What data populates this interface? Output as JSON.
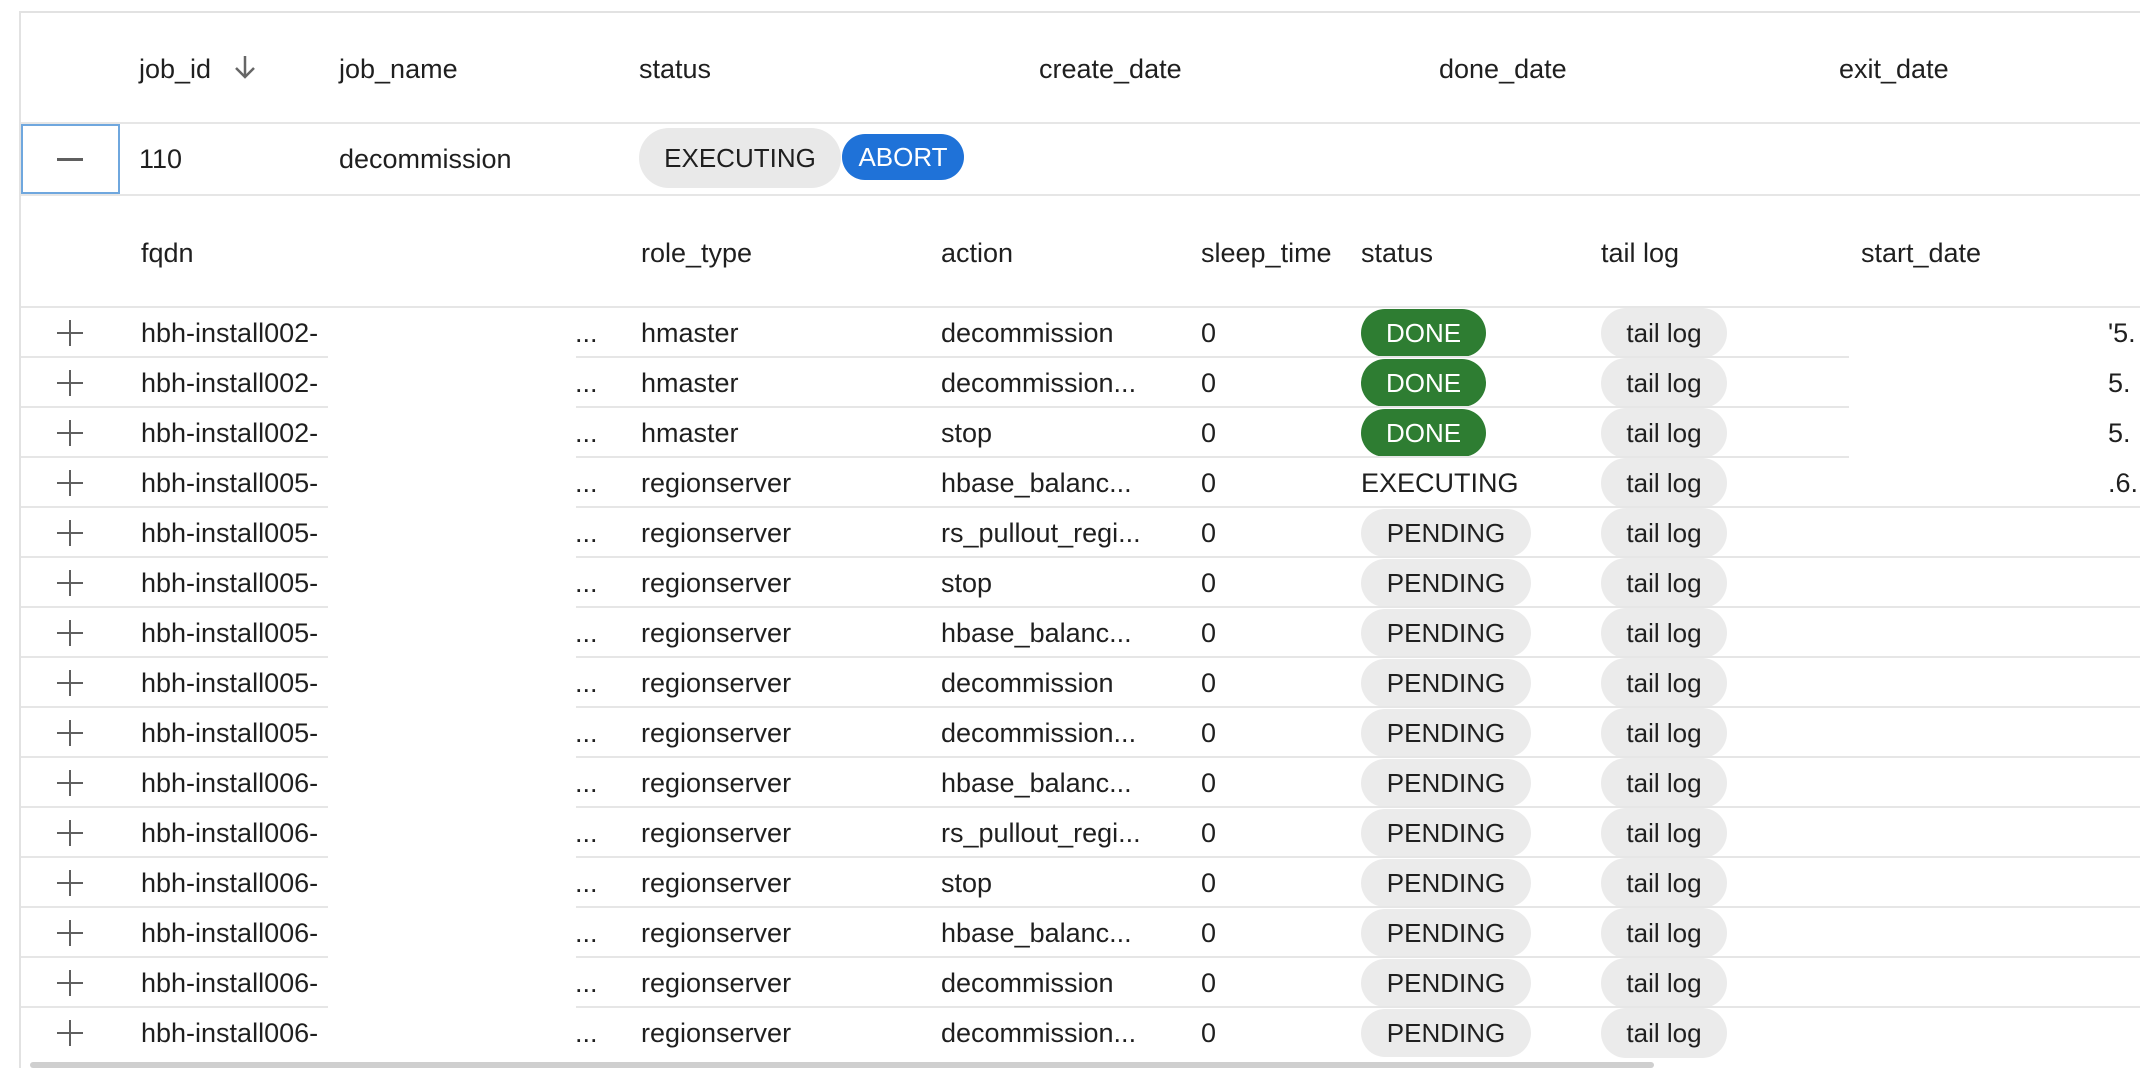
{
  "outer_table": {
    "columns": [
      "job_id",
      "job_name",
      "status",
      "create_date",
      "done_date",
      "exit_date"
    ],
    "sort_column": "job_id",
    "sort_direction": "descending"
  },
  "job": {
    "id": "110",
    "name": "decommission",
    "status": "EXECUTING",
    "abort_label": "ABORT"
  },
  "inner_table": {
    "columns": [
      "fqdn",
      "role_type",
      "action",
      "sleep_time",
      "status",
      "tail log",
      "start_date"
    ],
    "rows": [
      {
        "fqdn": "hbh-install002-",
        "ellipsis": "...",
        "role_type": "hmaster",
        "action": "decommission",
        "sleep_time": "0",
        "status": "DONE",
        "tail_log": "tail log",
        "start_date": "'5."
      },
      {
        "fqdn": "hbh-install002-",
        "ellipsis": "...",
        "role_type": "hmaster",
        "action": "decommission...",
        "sleep_time": "0",
        "status": "DONE",
        "tail_log": "tail log",
        "start_date": "5."
      },
      {
        "fqdn": "hbh-install002-",
        "ellipsis": "...",
        "role_type": "hmaster",
        "action": "stop",
        "sleep_time": "0",
        "status": "DONE",
        "tail_log": "tail log",
        "start_date": "5."
      },
      {
        "fqdn": "hbh-install005-",
        "ellipsis": "...",
        "role_type": "regionserver",
        "action": "hbase_balanc...",
        "sleep_time": "0",
        "status": "EXECUTING",
        "tail_log": "tail log",
        "start_date": ".6."
      },
      {
        "fqdn": "hbh-install005-",
        "ellipsis": "...",
        "role_type": "regionserver",
        "action": "rs_pullout_regi...",
        "sleep_time": "0",
        "status": "PENDING",
        "tail_log": "tail log",
        "start_date": ""
      },
      {
        "fqdn": "hbh-install005-",
        "ellipsis": "...",
        "role_type": "regionserver",
        "action": "stop",
        "sleep_time": "0",
        "status": "PENDING",
        "tail_log": "tail log",
        "start_date": ""
      },
      {
        "fqdn": "hbh-install005-",
        "ellipsis": "...",
        "role_type": "regionserver",
        "action": "hbase_balanc...",
        "sleep_time": "0",
        "status": "PENDING",
        "tail_log": "tail log",
        "start_date": ""
      },
      {
        "fqdn": "hbh-install005-",
        "ellipsis": "...",
        "role_type": "regionserver",
        "action": "decommission",
        "sleep_time": "0",
        "status": "PENDING",
        "tail_log": "tail log",
        "start_date": ""
      },
      {
        "fqdn": "hbh-install005-",
        "ellipsis": "...",
        "role_type": "regionserver",
        "action": "decommission...",
        "sleep_time": "0",
        "status": "PENDING",
        "tail_log": "tail log",
        "start_date": ""
      },
      {
        "fqdn": "hbh-install006-",
        "ellipsis": "...",
        "role_type": "regionserver",
        "action": "hbase_balanc...",
        "sleep_time": "0",
        "status": "PENDING",
        "tail_log": "tail log",
        "start_date": ""
      },
      {
        "fqdn": "hbh-install006-",
        "ellipsis": "...",
        "role_type": "regionserver",
        "action": "rs_pullout_regi...",
        "sleep_time": "0",
        "status": "PENDING",
        "tail_log": "tail log",
        "start_date": ""
      },
      {
        "fqdn": "hbh-install006-",
        "ellipsis": "...",
        "role_type": "regionserver",
        "action": "stop",
        "sleep_time": "0",
        "status": "PENDING",
        "tail_log": "tail log",
        "start_date": ""
      },
      {
        "fqdn": "hbh-install006-",
        "ellipsis": "...",
        "role_type": "regionserver",
        "action": "hbase_balanc...",
        "sleep_time": "0",
        "status": "PENDING",
        "tail_log": "tail log",
        "start_date": ""
      },
      {
        "fqdn": "hbh-install006-",
        "ellipsis": "...",
        "role_type": "regionserver",
        "action": "decommission",
        "sleep_time": "0",
        "status": "PENDING",
        "tail_log": "tail log",
        "start_date": ""
      },
      {
        "fqdn": "hbh-install006-",
        "ellipsis": "...",
        "role_type": "regionserver",
        "action": "decommission...",
        "sleep_time": "0",
        "status": "PENDING",
        "tail_log": "tail log",
        "start_date": ""
      }
    ]
  },
  "icons": {
    "sort": "arrow-down-icon",
    "collapse": "minus-icon",
    "expand": "plus-icon"
  },
  "colors": {
    "done": "#2e7d32",
    "abort": "#1f72d8",
    "chip_gray": "#e9e9e9",
    "focus_border": "#6fa7de"
  }
}
